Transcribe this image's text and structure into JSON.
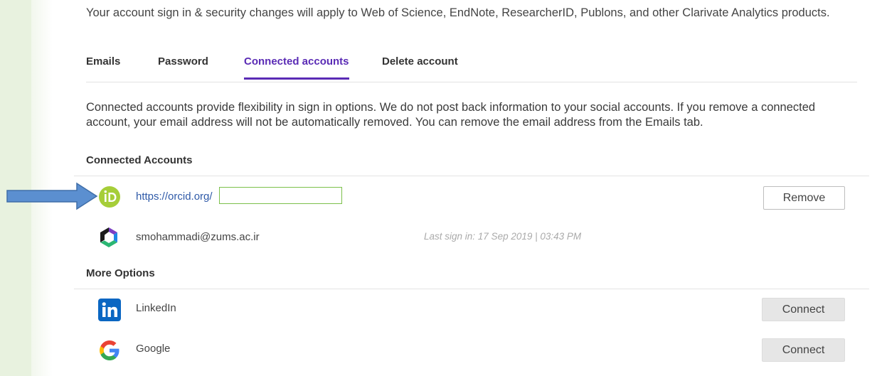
{
  "intro_text": "Your account sign in & security changes will apply to Web of Science, EndNote, ResearcherID, Publons, and other Clarivate Analytics products.",
  "tabs": [
    {
      "label": "Emails",
      "active": false
    },
    {
      "label": "Password",
      "active": false
    },
    {
      "label": "Connected accounts",
      "active": true
    },
    {
      "label": "Delete account",
      "active": false
    }
  ],
  "description": "Connected accounts provide flexibility in sign in options. We do not post back information to your social accounts. If you remove a connected account, your email address will not be automatically removed. You can remove the email address from the Emails tab.",
  "connected": {
    "title": "Connected Accounts",
    "orcid": {
      "icon": "orcid-icon",
      "url": "https://orcid.org/",
      "button": "Remove"
    },
    "clarivate": {
      "icon": "clarivate-icon",
      "email": "smohammadi@zums.ac.ir",
      "last_signin": "Last sign in: 17 Sep 2019 | 03:43 PM"
    }
  },
  "more_options": {
    "title": "More Options",
    "items": [
      {
        "name": "LinkedIn",
        "icon": "linkedin-icon",
        "button": "Connect"
      },
      {
        "name": "Google",
        "icon": "google-icon",
        "button": "Connect"
      }
    ]
  },
  "colors": {
    "accent": "#5a2bb5",
    "orcid_green": "#a6ce39",
    "linkedin_blue": "#0a66c2",
    "annotation_arrow": "#5b8fd0"
  }
}
